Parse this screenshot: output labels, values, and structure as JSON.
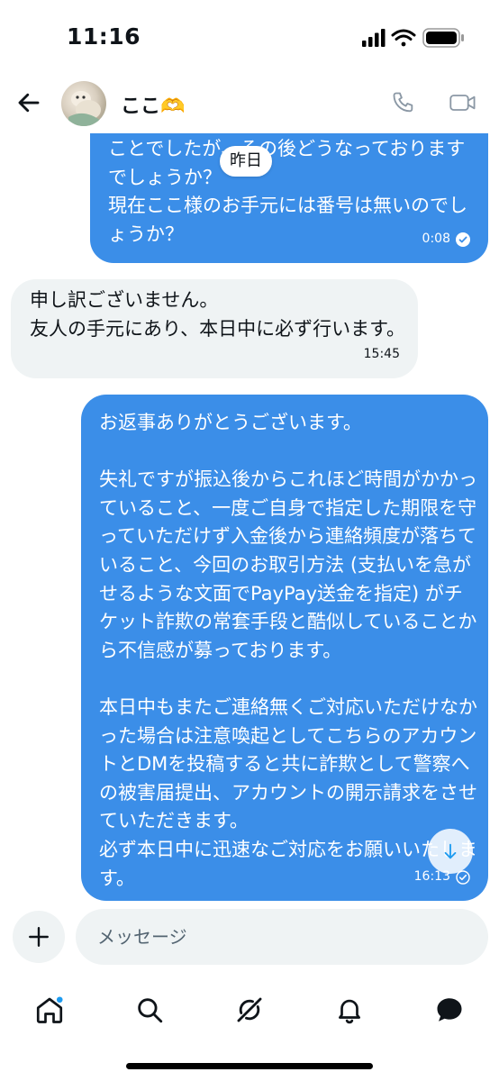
{
  "status_bar": {
    "time": "11:16"
  },
  "header": {
    "contact_name": "ここ🫶"
  },
  "date_divider": "昨日",
  "messages": [
    {
      "direction": "outgoing",
      "text": "ことでしたが、その後どうなっておりますでしょうか？\n現在ここ様のお手元には番号は無いのでしょうか？",
      "time": "0:08",
      "read": true
    },
    {
      "direction": "incoming",
      "text": "申し訳ございません。\n友人の手元にあり、本日中に必ず行います。",
      "time": "15:45"
    },
    {
      "direction": "outgoing",
      "text": "お返事ありがとうございます。\n\n失礼ですが振込後からこれほど時間がかかっていること、一度ご自身で指定した期限を守っていただけず入金後から連絡頻度が落ちていること、今回のお取引方法 (支払いを急がせるような文面でPayPay送金を指定) がチケット詐欺の常套手段と酷似していることから不信感が募っております。\n\n本日中もまたご連絡無くご対応いただけなかった場合は注意喚起としてこちらのアカウントとDMを投稿すると共に詐欺として警察への被害届提出、アカウントの開示請求をさせていただきます。\n必ず本日中に迅速なご対応をお願いいたします。",
      "time": "16:13",
      "read": true
    }
  ],
  "composer": {
    "placeholder": "メッセージ"
  },
  "tabbar": {
    "items": [
      "home-icon",
      "search-icon",
      "grok-icon",
      "notifications-icon",
      "messages-icon"
    ],
    "home_has_badge": true
  },
  "colors": {
    "accent": "#1d9bf0",
    "outgoing_bubble": "#3b8ee8",
    "incoming_bubble": "#eff3f4"
  }
}
